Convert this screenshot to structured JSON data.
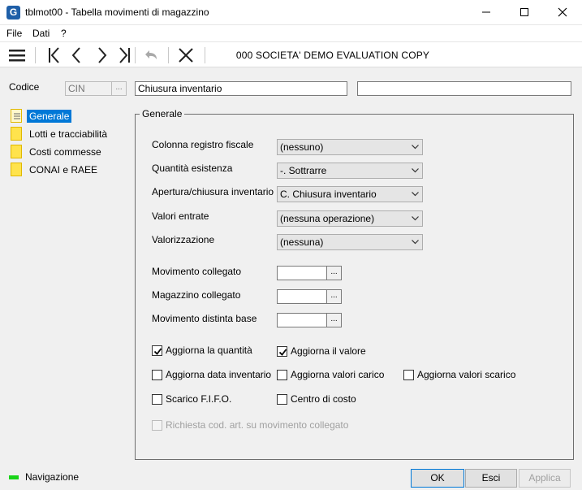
{
  "window": {
    "icon_letter": "G",
    "title": "tblmot00 - Tabella movimenti di magazzino"
  },
  "menu": {
    "items": [
      {
        "label": "File"
      },
      {
        "label": "Dati"
      },
      {
        "label": "?"
      }
    ]
  },
  "toolbar": {
    "company": "000 SOCIETA' DEMO EVALUATION COPY",
    "icons": [
      "menu-icon",
      "first-record-icon",
      "previous-record-icon",
      "next-record-icon",
      "last-record-icon",
      "undo-icon",
      "delete-icon"
    ]
  },
  "codice": {
    "label": "Codice",
    "code": "CIN",
    "lookup": "...",
    "description": "Chiusura inventario",
    "extra": ""
  },
  "tree": {
    "items": [
      {
        "label": "Generale",
        "selected": true
      },
      {
        "label": "Lotti e tracciabilità",
        "selected": false
      },
      {
        "label": "Costi commesse",
        "selected": false
      },
      {
        "label": "CONAI e RAEE",
        "selected": false
      }
    ]
  },
  "general": {
    "title": "Generale",
    "colonna": {
      "label": "Colonna registro fiscale",
      "value": "(nessuno)"
    },
    "quantita": {
      "label": "Quantità esistenza",
      "value": "-. Sottrarre"
    },
    "apertura": {
      "label": "Apertura/chiusura inventario",
      "value": "C. Chiusura inventario"
    },
    "valori": {
      "label": "Valori entrate",
      "value": "(nessuna operazione)"
    },
    "valorizzazione": {
      "label": "Valorizzazione",
      "value": "(nessuna)"
    },
    "mov_collegato": {
      "label": "Movimento collegato",
      "value": "",
      "lookup": "..."
    },
    "mag_collegato": {
      "label": "Magazzino collegato",
      "value": "",
      "lookup": "..."
    },
    "mov_distinta": {
      "label": "Movimento distinta base",
      "value": "",
      "lookup": "..."
    },
    "checks": {
      "agg_quantita": {
        "label": "Aggiorna la quantità",
        "checked": true
      },
      "agg_valore": {
        "label": "Aggiorna il valore",
        "checked": true
      },
      "agg_data_inv": {
        "label": "Aggiorna data inventario",
        "checked": false
      },
      "agg_val_carico": {
        "label": "Aggiorna valori carico",
        "checked": false
      },
      "agg_val_scarico": {
        "label": "Aggiorna valori scarico",
        "checked": false
      },
      "scarico_fifo": {
        "label": "Scarico F.I.F.O.",
        "checked": false
      },
      "centro_costo": {
        "label": "Centro di costo",
        "checked": false
      },
      "richiesta_cod": {
        "label": "Richiesta cod. art. su movimento collegato",
        "checked": false,
        "disabled": true
      }
    }
  },
  "status": {
    "text": "Navigazione",
    "indicator_color": "#19d419"
  },
  "buttons": {
    "ok": "OK",
    "esci": "Esci",
    "applica": "Applica"
  }
}
